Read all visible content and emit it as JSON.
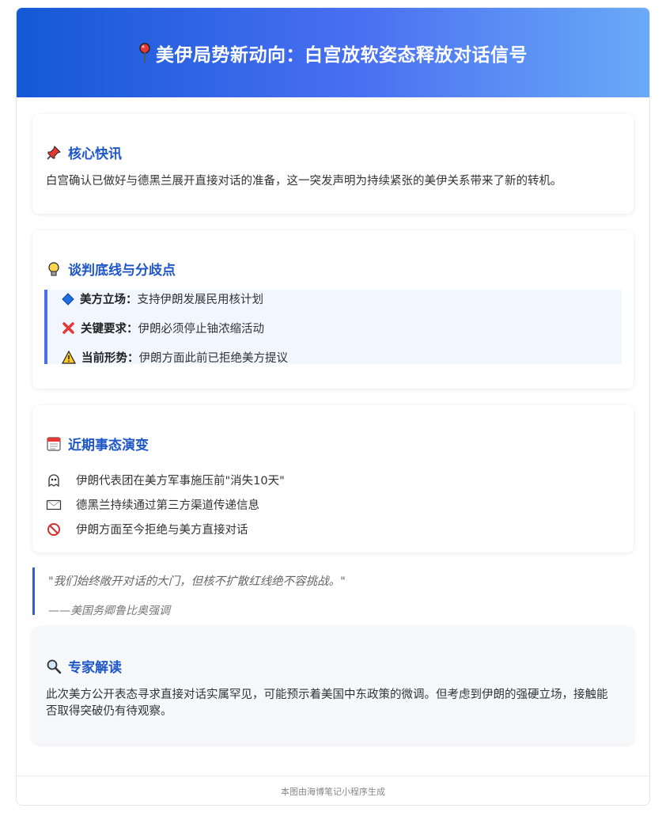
{
  "header": {
    "title": "美伊局势新动向：白宫放软姿态释放对话信号",
    "icon": "pin-icon"
  },
  "core": {
    "title": "核心快讯",
    "icon": "pushpin-icon",
    "text": "白宫确认已做好与德黑兰展开直接对话的准备，这一突发声明为持续紧张的美伊关系带来了新的转机。"
  },
  "bottomline": {
    "title": "谈判底线与分歧点",
    "icon": "lightbulb-icon",
    "accent": "#4a6fe8",
    "items": [
      {
        "icon": "diamond-icon",
        "label": "美方立场：",
        "value": "支持伊朗发展民用核计划"
      },
      {
        "icon": "cross-icon",
        "label": "关键要求：",
        "value": "伊朗必须停止铀浓缩活动"
      },
      {
        "icon": "warning-icon",
        "label": "当前形势：",
        "value": "伊朗方面此前已拒绝美方提议"
      }
    ]
  },
  "events": {
    "title": "近期事态演变",
    "icon": "calendar-icon",
    "items": [
      {
        "icon": "ghost-icon",
        "text": "伊朗代表团在美方军事施压前\"消失10天\""
      },
      {
        "icon": "envelope-icon",
        "text": "德黑兰持续通过第三方渠道传递信息"
      },
      {
        "icon": "prohibited-icon",
        "text": "伊朗方面至今拒绝与美方直接对话"
      }
    ]
  },
  "quote": {
    "text": "\"我们始终敞开对话的大门，但核不扩散红线绝不容挑战。\"",
    "source": "——美国务卿鲁比奥强调"
  },
  "expert": {
    "title": "专家解读",
    "icon": "magnifier-icon",
    "text": "此次美方公开表态寻求直接对话实属罕见，可能预示着美国中东政策的微调。但考虑到伊朗的强硬立场，接触能否取得突破仍有待观察。"
  },
  "footer": {
    "text": "本图由海博笔记小程序生成"
  },
  "colors": {
    "brand": "#1e56c8",
    "banner_start": "#1458d6",
    "banner_end": "#6aaaf6"
  }
}
